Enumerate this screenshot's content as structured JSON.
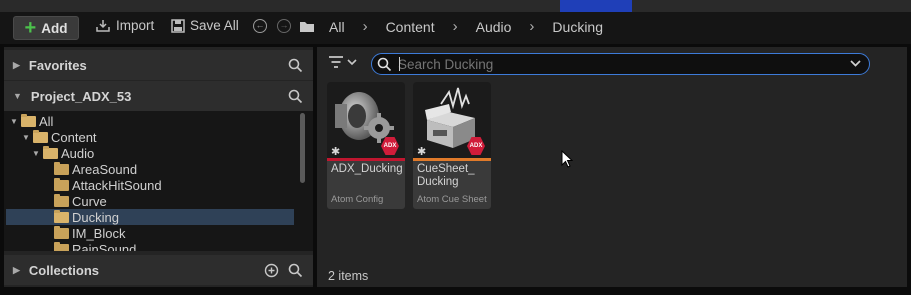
{
  "toolbar": {
    "add_label": "Add",
    "import_label": "Import",
    "save_all_label": "Save All"
  },
  "breadcrumb": [
    "All",
    "Content",
    "Audio",
    "Ducking"
  ],
  "left_panel": {
    "favorites_label": "Favorites",
    "project_label": "Project_ADX_53",
    "collections_label": "Collections",
    "tree": [
      {
        "label": "All",
        "depth": 0,
        "expanded": true
      },
      {
        "label": "Content",
        "depth": 1,
        "expanded": true
      },
      {
        "label": "Audio",
        "depth": 2,
        "expanded": true
      },
      {
        "label": "AreaSound",
        "depth": 3
      },
      {
        "label": "AttackHitSound",
        "depth": 3
      },
      {
        "label": "Curve",
        "depth": 3
      },
      {
        "label": "Ducking",
        "depth": 3,
        "selected": true
      },
      {
        "label": "IM_Block",
        "depth": 3
      },
      {
        "label": "RainSound",
        "depth": 3
      }
    ]
  },
  "search": {
    "placeholder": "Search Ducking"
  },
  "assets": [
    {
      "name": "ADX_Ducking",
      "type": "Atom Config",
      "bar_color": "#c0162f",
      "icon": "speaker-gear-icon"
    },
    {
      "name": "CueSheet_ Ducking",
      "type": "Atom Cue Sheet",
      "bar_color": "#e07a2a",
      "icon": "cue-sheet-box-icon"
    }
  ],
  "badge_label": "ADX",
  "item_count": "2 items",
  "colors": {
    "accent": "#3d7bd9",
    "selection": "#2f4157",
    "folder": "#c8a25a",
    "add_plus": "#4cc24c"
  }
}
